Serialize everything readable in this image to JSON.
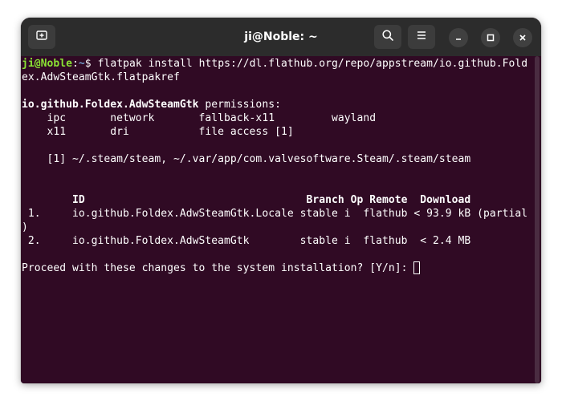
{
  "window": {
    "title": "ji@Noble: ~"
  },
  "titlebar_icons": {
    "new_tab": "new-tab-icon",
    "search": "search-icon",
    "menu": "hamburger-menu-icon",
    "minimize": "minimize-icon",
    "maximize": "maximize-icon",
    "close": "close-icon"
  },
  "colors": {
    "terminal_bg": "#300a24",
    "titlebar_bg": "#2c2c2c",
    "prompt_user": "#8ae234",
    "prompt_path": "#729fcf",
    "text": "#ffffff"
  },
  "terminal": {
    "prompt_user": "ji@Noble",
    "prompt_colon": ":",
    "prompt_path": "~",
    "prompt_symbol": "$ ",
    "command_line1": "flatpak install https://dl.flathub.org/repo/appstream/io.github.Fold",
    "command_line2": "ex.AdwSteamGtk.flatpakref",
    "permissions_app": "io.github.Foldex.AdwSteamGtk",
    "permissions_label": " permissions:",
    "perm_row1": "    ipc       network       fallback-x11         wayland",
    "perm_row2": "    x11       dri           file access [1]",
    "file_access_note": "    [1] ~/.steam/steam, ~/.var/app/com.valvesoftware.Steam/.steam/steam",
    "table_header": "        ID                                   Branch Op Remote  Download",
    "row1_line1": " 1.     io.github.Foldex.AdwSteamGtk.Locale stable i  flathub < 93.9 kB (partial",
    "row1_line2": ")",
    "row2": " 2.     io.github.Foldex.AdwSteamGtk        stable i  flathub  < 2.4 MB",
    "confirm_prompt": "Proceed with these changes to the system installation? [Y/n]: "
  }
}
